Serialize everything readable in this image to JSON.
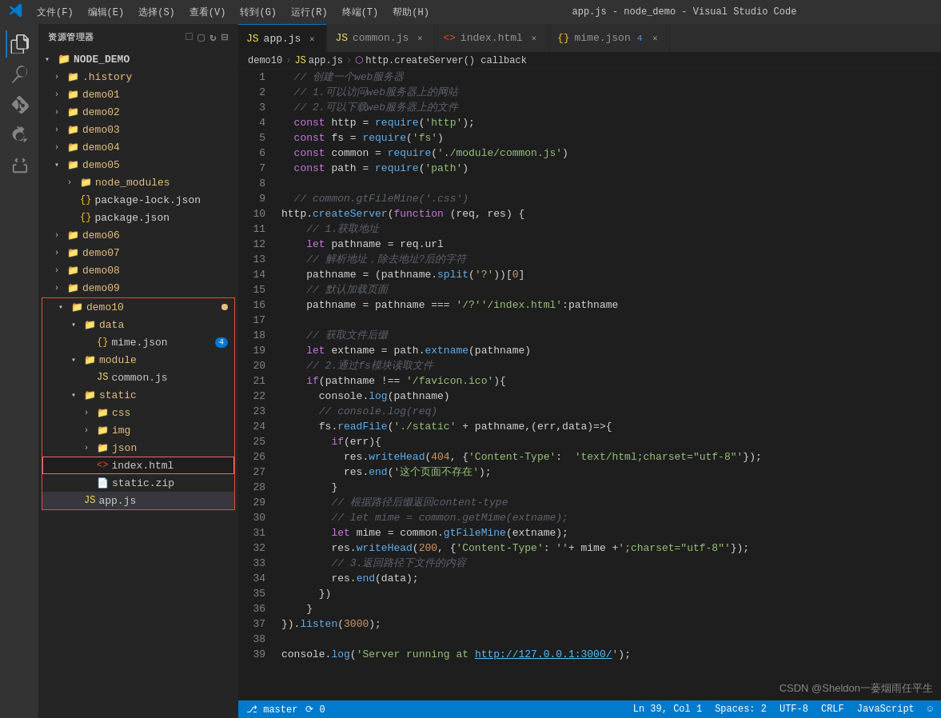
{
  "titlebar": {
    "logo": "VS",
    "title": "app.js - node_demo - Visual Studio Code",
    "menu": [
      "文件(F)",
      "编辑(E)",
      "选择(S)",
      "查看(V)",
      "转到(G)",
      "运行(R)",
      "终端(T)",
      "帮助(H)"
    ]
  },
  "sidebar": {
    "title": "资源管理器",
    "root": "NODE_DEMO",
    "items": [
      {
        "name": ".history",
        "type": "folder",
        "indent": 1,
        "collapsed": true
      },
      {
        "name": "demo01",
        "type": "folder",
        "indent": 1,
        "collapsed": true
      },
      {
        "name": "demo02",
        "type": "folder",
        "indent": 1,
        "collapsed": true
      },
      {
        "name": "demo03",
        "type": "folder",
        "indent": 1,
        "collapsed": true
      },
      {
        "name": "demo04",
        "type": "folder",
        "indent": 1,
        "collapsed": true
      },
      {
        "name": "demo05",
        "type": "folder",
        "indent": 1,
        "collapsed": false
      },
      {
        "name": "node_modules",
        "type": "folder",
        "indent": 2,
        "collapsed": true
      },
      {
        "name": "package-lock.json",
        "type": "json",
        "indent": 2
      },
      {
        "name": "package.json",
        "type": "json",
        "indent": 2
      },
      {
        "name": "demo06",
        "type": "folder",
        "indent": 1,
        "collapsed": true
      },
      {
        "name": "demo07",
        "type": "folder",
        "indent": 1,
        "collapsed": true
      },
      {
        "name": "demo08",
        "type": "folder",
        "indent": 1,
        "collapsed": true
      },
      {
        "name": "demo09",
        "type": "folder",
        "indent": 1,
        "collapsed": true
      },
      {
        "name": "demo10",
        "type": "folder",
        "indent": 1,
        "collapsed": false,
        "highlight": true
      },
      {
        "name": "data",
        "type": "folder",
        "indent": 2,
        "collapsed": false
      },
      {
        "name": "mime.json",
        "type": "json",
        "indent": 3,
        "badge": "4"
      },
      {
        "name": "module",
        "type": "folder",
        "indent": 2,
        "collapsed": false
      },
      {
        "name": "common.js",
        "type": "js",
        "indent": 3
      },
      {
        "name": "static",
        "type": "folder",
        "indent": 2,
        "collapsed": false
      },
      {
        "name": "css",
        "type": "folder",
        "indent": 3,
        "collapsed": true
      },
      {
        "name": "img",
        "type": "folder",
        "indent": 3,
        "collapsed": true
      },
      {
        "name": "json",
        "type": "folder",
        "indent": 3,
        "collapsed": true
      },
      {
        "name": "index.html",
        "type": "html",
        "indent": 3,
        "active": true
      },
      {
        "name": "static.zip",
        "type": "zip",
        "indent": 3
      },
      {
        "name": "app.js",
        "type": "js",
        "indent": 2,
        "modified": true
      }
    ]
  },
  "tabs": [
    {
      "name": "app.js",
      "type": "js",
      "active": true
    },
    {
      "name": "common.js",
      "type": "js",
      "active": false
    },
    {
      "name": "index.html",
      "type": "html",
      "active": false
    },
    {
      "name": "mime.json",
      "type": "json",
      "active": false,
      "badge": "4"
    }
  ],
  "breadcrumb": [
    "demo10",
    "app.js",
    "http.createServer() callback"
  ],
  "code": {
    "lines": [
      {
        "n": 1,
        "content": "  // 创建一个web服务器"
      },
      {
        "n": 2,
        "content": "  // 1.可以访问web服务器上的网站"
      },
      {
        "n": 3,
        "content": "  // 2.可以下载web服务器上的文件"
      },
      {
        "n": 4,
        "content": "  const http = require('http');"
      },
      {
        "n": 5,
        "content": "  const fs = require('fs')"
      },
      {
        "n": 6,
        "content": "  const common = require('./module/common.js')"
      },
      {
        "n": 7,
        "content": "  const path = require('path')"
      },
      {
        "n": 8,
        "content": ""
      },
      {
        "n": 9,
        "content": "  // common.gtFileMine('.css')"
      },
      {
        "n": 10,
        "content": "http.createServer(function (req, res) {"
      },
      {
        "n": 11,
        "content": "    // 1.获取地址"
      },
      {
        "n": 12,
        "content": "    let pathname = req.url"
      },
      {
        "n": 13,
        "content": "    // 解析地址，除去地址?后的字符"
      },
      {
        "n": 14,
        "content": "    pathname = (pathname.split('?'))[0]"
      },
      {
        "n": 15,
        "content": "    // 默认加载页面"
      },
      {
        "n": 16,
        "content": "    pathname = pathname === '/?'/index.html':pathname"
      },
      {
        "n": 17,
        "content": ""
      },
      {
        "n": 18,
        "content": "    // 获取文件后缀"
      },
      {
        "n": 19,
        "content": "    let extname = path.extname(pathname)"
      },
      {
        "n": 20,
        "content": "    // 2.通过fs模块读取文件"
      },
      {
        "n": 21,
        "content": "    if(pathname !== '/favicon.ico'){"
      },
      {
        "n": 22,
        "content": "      console.log(pathname)"
      },
      {
        "n": 23,
        "content": "      // console.log(req)"
      },
      {
        "n": 24,
        "content": "      fs.readFile('./static' + pathname,(err,data)=>{"
      },
      {
        "n": 25,
        "content": "        if(err){"
      },
      {
        "n": 26,
        "content": "          res.writeHead(404, {'Content-Type': 'text/html;charset=\"utf-8\"'});"
      },
      {
        "n": 27,
        "content": "          res.end('这个页面不存在');"
      },
      {
        "n": 28,
        "content": "        }"
      },
      {
        "n": 29,
        "content": "        // 根据路径后缀返回content-type"
      },
      {
        "n": 30,
        "content": "        // let mime = common.getMime(extname);"
      },
      {
        "n": 31,
        "content": "        let mime = common.gtFileMine(extname);"
      },
      {
        "n": 32,
        "content": "        res.writeHead(200, {'Content-Type': ''+ mime +';charset=\"utf-8\"'});"
      },
      {
        "n": 33,
        "content": "        // 3.返回路径下文件的内容"
      },
      {
        "n": 34,
        "content": "        res.end(data);"
      },
      {
        "n": 35,
        "content": "      })"
      },
      {
        "n": 36,
        "content": "    }"
      },
      {
        "n": 37,
        "content": "}).listen(3000);"
      },
      {
        "n": 38,
        "content": ""
      },
      {
        "n": 39,
        "content": "console.log('Server running at http://127.0.0.1:3000/');"
      }
    ]
  },
  "watermark": "CSDN @Sheldon一蒌烟雨任平生",
  "status": ""
}
